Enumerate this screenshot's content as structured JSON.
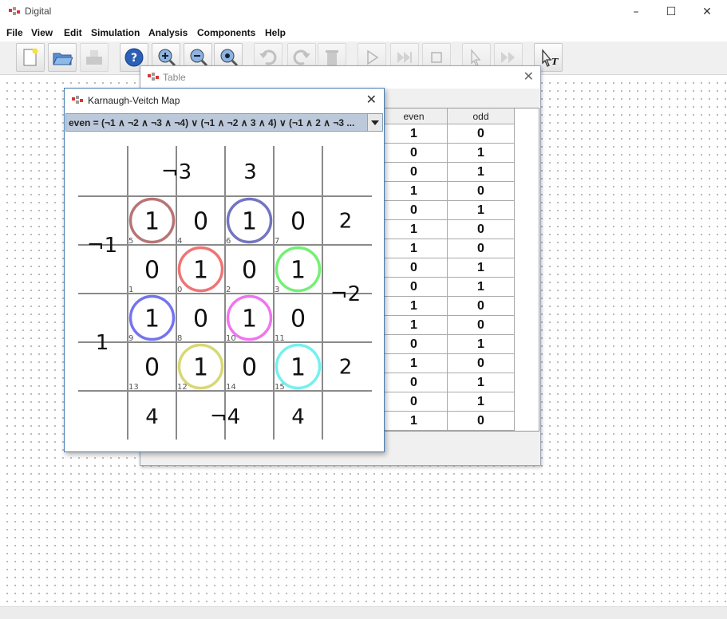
{
  "app": {
    "title": "Digital"
  },
  "menu": [
    "File",
    "View",
    "Edit",
    "Simulation",
    "Analysis",
    "Components",
    "Help"
  ],
  "toolbar": {
    "buttons": [
      {
        "name": "new-icon"
      },
      {
        "name": "open-icon"
      },
      {
        "name": "save-icon"
      },
      {
        "name": "help-icon"
      },
      {
        "name": "zoom-in-icon"
      },
      {
        "name": "zoom-out-icon"
      },
      {
        "name": "fit-icon"
      },
      {
        "name": "undo-icon"
      },
      {
        "name": "redo-icon"
      },
      {
        "name": "delete-icon"
      },
      {
        "name": "play-icon"
      },
      {
        "name": "step-icon"
      },
      {
        "name": "stop-icon"
      },
      {
        "name": "micro-step-icon"
      },
      {
        "name": "run-to-break-icon"
      },
      {
        "name": "test-icon"
      }
    ]
  },
  "table_window": {
    "title": "Table",
    "columns": [
      "even",
      "odd"
    ],
    "rows": [
      [
        "1",
        "0"
      ],
      [
        "0",
        "1"
      ],
      [
        "0",
        "1"
      ],
      [
        "1",
        "0"
      ],
      [
        "0",
        "1"
      ],
      [
        "1",
        "0"
      ],
      [
        "1",
        "0"
      ],
      [
        "0",
        "1"
      ],
      [
        "0",
        "1"
      ],
      [
        "1",
        "0"
      ],
      [
        "1",
        "0"
      ],
      [
        "0",
        "1"
      ],
      [
        "1",
        "0"
      ],
      [
        "0",
        "1"
      ],
      [
        "0",
        "1"
      ],
      [
        "1",
        "0"
      ]
    ]
  },
  "kv_window": {
    "title": "Karnaugh-Veitch Map",
    "expression": "even = (¬1 ∧ ¬2 ∧ ¬3 ∧ ¬4) ∨ (¬1 ∧ ¬2 ∧ 3 ∧ 4) ∨ (¬1 ∧ 2 ∧ ¬3 ...",
    "top_labels": [
      "¬3",
      "3"
    ],
    "bottom_labels": [
      "4",
      "¬4",
      "4"
    ],
    "left_labels": [
      "¬1",
      "1"
    ],
    "right_labels": [
      "2",
      "¬2",
      "2"
    ],
    "cells": [
      [
        {
          "v": "1",
          "i": "5"
        },
        {
          "v": "0",
          "i": "4"
        },
        {
          "v": "1",
          "i": "6"
        },
        {
          "v": "0",
          "i": "7"
        }
      ],
      [
        {
          "v": "0",
          "i": "1"
        },
        {
          "v": "1",
          "i": "0"
        },
        {
          "v": "0",
          "i": "2"
        },
        {
          "v": "1",
          "i": "3"
        }
      ],
      [
        {
          "v": "1",
          "i": "9"
        },
        {
          "v": "0",
          "i": "8"
        },
        {
          "v": "1",
          "i": "10"
        },
        {
          "v": "0",
          "i": "11"
        }
      ],
      [
        {
          "v": "0",
          "i": "13"
        },
        {
          "v": "1",
          "i": "12"
        },
        {
          "v": "0",
          "i": "14"
        },
        {
          "v": "1",
          "i": "15"
        }
      ]
    ],
    "circles": [
      {
        "row": 0,
        "col": 0,
        "color": "#b87474"
      },
      {
        "row": 0,
        "col": 2,
        "color": "#7474c0"
      },
      {
        "row": 1,
        "col": 1,
        "color": "#f07474"
      },
      {
        "row": 1,
        "col": 3,
        "color": "#74f074"
      },
      {
        "row": 2,
        "col": 0,
        "color": "#7474f0"
      },
      {
        "row": 2,
        "col": 2,
        "color": "#f074f0"
      },
      {
        "row": 3,
        "col": 1,
        "color": "#d8d874"
      },
      {
        "row": 3,
        "col": 3,
        "color": "#74f0f0"
      }
    ]
  }
}
